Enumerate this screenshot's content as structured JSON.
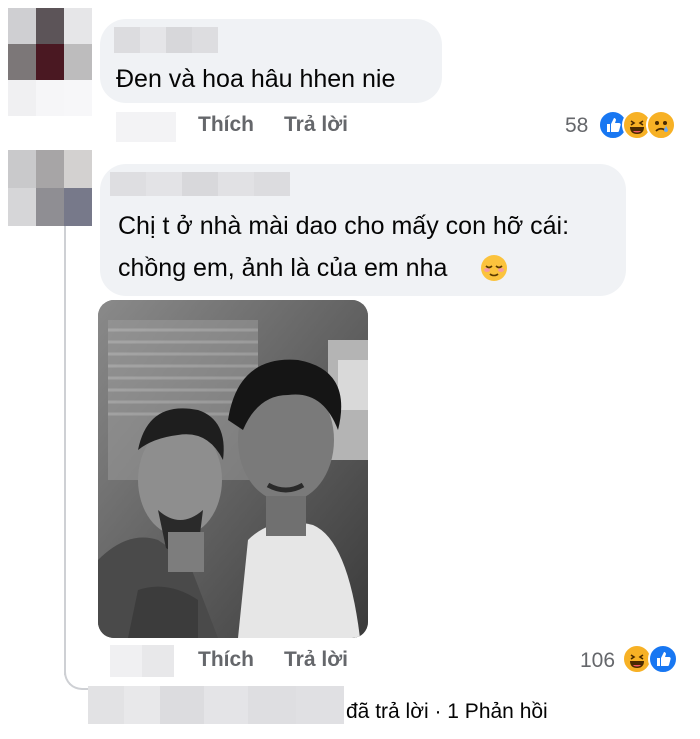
{
  "comment1": {
    "text": "Đen  và hoa hâu hhen nie",
    "like_label": "Thích",
    "reply_label": "Trả lời",
    "reaction_count": "58",
    "reactions": [
      "like-icon",
      "haha-icon",
      "sad-icon"
    ]
  },
  "comment2": {
    "text_line1": "Chị t ở nhà mài dao cho mấy con hỡ cái:",
    "text_line2": "chồng em, ảnh là của em nha",
    "emoji": "relieved-face-icon",
    "photo": "black-and-white-selfie-photo",
    "like_label": "Thích",
    "reply_label": "Trả lời",
    "reaction_count": "106",
    "reactions": [
      "haha-icon",
      "like-icon"
    ]
  },
  "reply_summary": {
    "text": "đã trả lời · 1 Phản hồi"
  },
  "colors": {
    "bubble": "#f0f2f5",
    "text": "#050505",
    "secondary": "#65676b",
    "like": "#1877f2",
    "haha": "#f7b125"
  }
}
